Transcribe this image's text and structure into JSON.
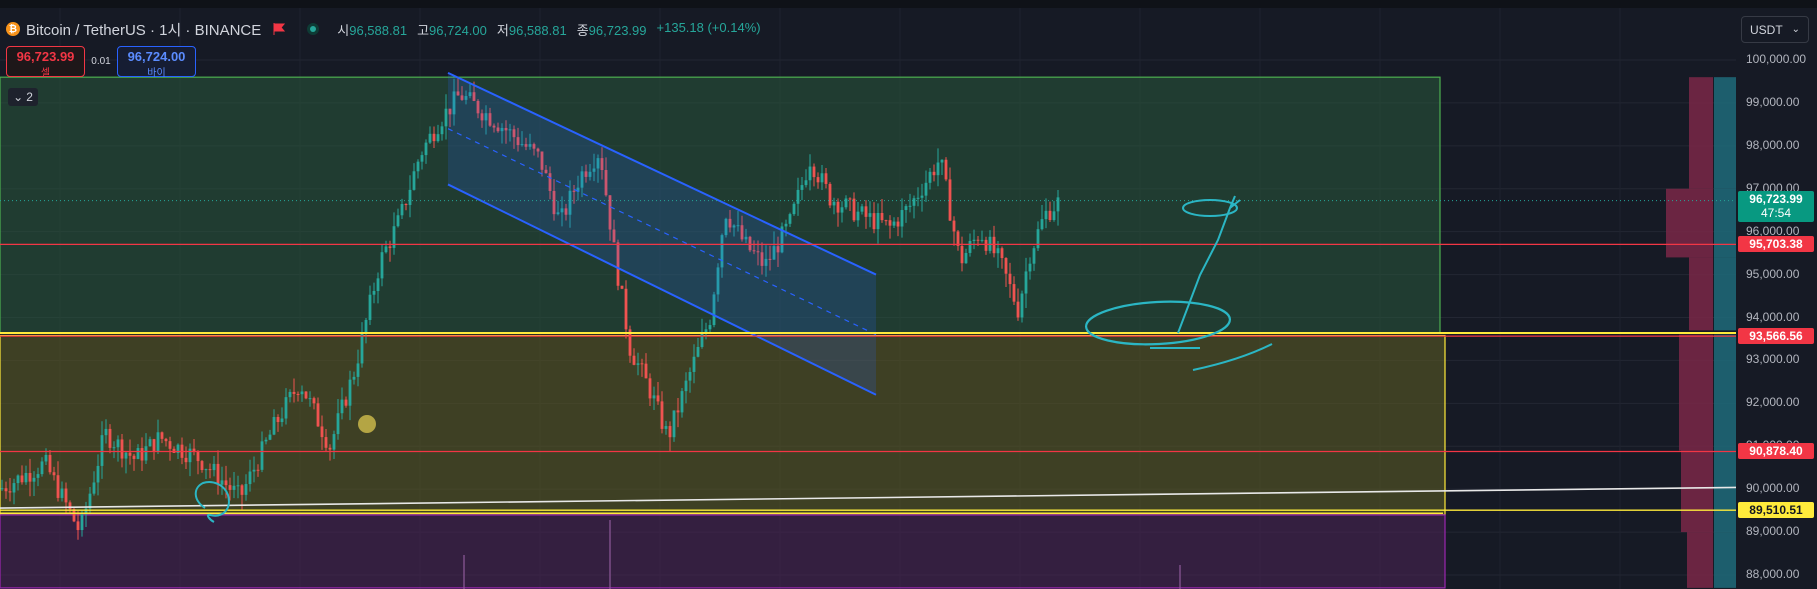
{
  "header": {
    "logo_letter": "₿",
    "symbol_title": "Bitcoin / TetherUS · 1시 · BINANCE",
    "ohlc": [
      {
        "label": "시",
        "value": "96,588.81"
      },
      {
        "label": "고",
        "value": "96,724.00"
      },
      {
        "label": "저",
        "value": "96,588.81"
      },
      {
        "label": "종",
        "value": "96,723.99"
      }
    ],
    "change": "+135.18 (+0.14%)"
  },
  "trade": {
    "sell_price": "96,723.99",
    "sell_label": "셀",
    "spread": "0.01",
    "buy_price": "96,724.00",
    "buy_label": "바이"
  },
  "indicators_toggle": {
    "count": "2"
  },
  "currency": {
    "value": "USDT"
  },
  "colors": {
    "background": "#161a25",
    "up": "#26a69a",
    "down": "#ef5350",
    "support_line": "#f23645",
    "highlight": "#ffeb3b",
    "channel": "#2962ff",
    "drawing": "#2bb6c4",
    "green_zone": "#4caf50",
    "yellow_zone": "#ffeb3b",
    "purple_zone": "#7b2f8f"
  },
  "icons": {
    "logo": "bitcoin-logo-icon",
    "flag": "flag-icon",
    "status": "market-open-dot-icon",
    "collapse": "chevron-down-icon",
    "dropdown": "chevron-down-icon"
  },
  "chart_data": {
    "type": "candlestick",
    "interval": "1h",
    "y_range": [
      87700,
      100400
    ],
    "y_ticks": [
      "100,000.00",
      "99,000.00",
      "98,000.00",
      "97,000.00",
      "96,000.00",
      "95,000.00",
      "94,000.00",
      "93,000.00",
      "92,000.00",
      "91,000.00",
      "90,000.00",
      "89,000.00",
      "88,000.00"
    ],
    "y_tick_values": [
      100000,
      99000,
      98000,
      97000,
      96000,
      95000,
      94000,
      93000,
      92000,
      91000,
      90000,
      89000,
      88000
    ],
    "path": [
      [
        0,
        90000
      ],
      [
        45,
        90600
      ],
      [
        80,
        89000
      ],
      [
        105,
        91300
      ],
      [
        135,
        90700
      ],
      [
        160,
        91200
      ],
      [
        200,
        90700
      ],
      [
        240,
        89800
      ],
      [
        275,
        91500
      ],
      [
        300,
        92500
      ],
      [
        330,
        91000
      ],
      [
        355,
        92800
      ],
      [
        380,
        95300
      ],
      [
        400,
        96300
      ],
      [
        420,
        97800
      ],
      [
        440,
        98600
      ],
      [
        460,
        99200
      ],
      [
        500,
        98500
      ],
      [
        540,
        97700
      ],
      [
        560,
        96200
      ],
      [
        580,
        97300
      ],
      [
        600,
        97900
      ],
      [
        615,
        95400
      ],
      [
        630,
        93300
      ],
      [
        650,
        92300
      ],
      [
        668,
        91200
      ],
      [
        690,
        92700
      ],
      [
        710,
        94000
      ],
      [
        725,
        96500
      ],
      [
        745,
        95700
      ],
      [
        765,
        95200
      ],
      [
        790,
        96200
      ],
      [
        810,
        97700
      ],
      [
        830,
        96800
      ],
      [
        860,
        96400
      ],
      [
        890,
        96100
      ],
      [
        910,
        96600
      ],
      [
        940,
        97700
      ],
      [
        960,
        95300
      ],
      [
        980,
        96000
      ],
      [
        1000,
        95300
      ],
      [
        1018,
        94200
      ],
      [
        1030,
        95500
      ],
      [
        1045,
        96400
      ],
      [
        1060,
        96723.99
      ]
    ],
    "candle_count": 265,
    "horizontal_levels": [
      {
        "price": 95703.38,
        "label": "95,703.38",
        "color": "#f23645"
      },
      {
        "price": 93566.56,
        "label": "93,566.56",
        "color": "#f23645"
      },
      {
        "price": 90878.4,
        "label": "90,878.40",
        "color": "#f23645"
      },
      {
        "price": 89510.51,
        "label": "89,510.51",
        "color": "#ffeb3b"
      }
    ],
    "zones": [
      {
        "name": "green",
        "top": 99600,
        "bottom": 93640,
        "color": "#4caf50"
      },
      {
        "name": "yellow",
        "top": 93580,
        "bottom": 89400,
        "color": "#ffeb3b"
      },
      {
        "name": "purple",
        "top": 89400,
        "bottom": 87700,
        "color": "#7b2f8f"
      }
    ],
    "channel": {
      "upper": [
        [
          448,
          99700
        ],
        [
          876,
          95000
        ]
      ],
      "lower": [
        [
          448,
          97100
        ],
        [
          876,
          92200
        ]
      ],
      "mid": [
        [
          448,
          98400
        ],
        [
          876,
          93600
        ]
      ]
    },
    "trendline": {
      "from": [
        0,
        89560
      ],
      "to": [
        1736,
        90040
      ]
    },
    "current_price": {
      "label": "96,723.99",
      "timer": "47:54",
      "price": 96723.99
    }
  }
}
